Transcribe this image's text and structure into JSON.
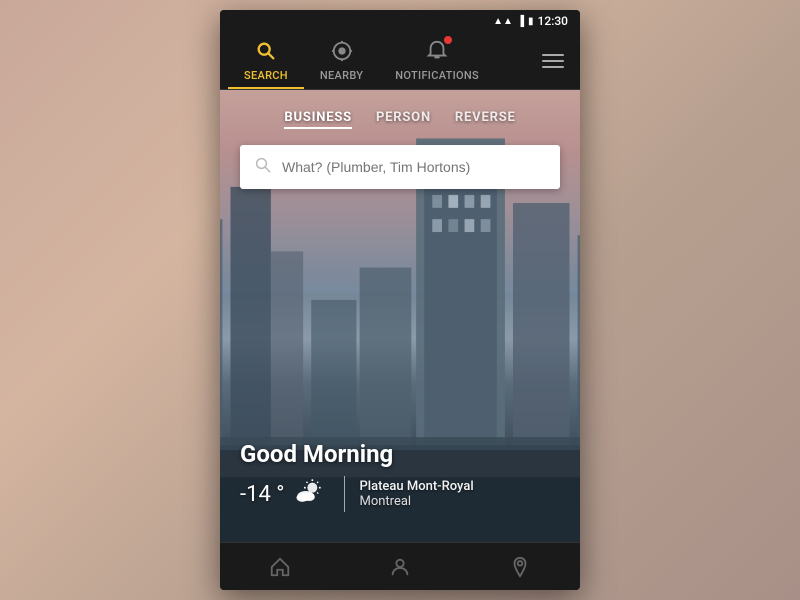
{
  "statusBar": {
    "time": "12:30",
    "icons": [
      "wifi",
      "signal",
      "battery"
    ]
  },
  "topNav": {
    "tabs": [
      {
        "id": "search",
        "label": "Search",
        "icon": "🔍",
        "active": true
      },
      {
        "id": "nearby",
        "label": "Nearby",
        "icon": "⊘",
        "active": false
      },
      {
        "id": "notifications",
        "label": "Notifications",
        "icon": "🔔",
        "active": false,
        "badge": true
      }
    ],
    "menuIcon": "☰"
  },
  "searchCategories": [
    {
      "id": "business",
      "label": "BUSINESS",
      "active": true
    },
    {
      "id": "person",
      "label": "PERSON",
      "active": false
    },
    {
      "id": "reverse",
      "label": "REVERSE",
      "active": false
    }
  ],
  "searchBox": {
    "placeholder": "What? (Plumber, Tim Hortons)"
  },
  "greeting": {
    "text": "Good Morning"
  },
  "weather": {
    "temperature": "-14 °",
    "location_neighborhood": "Plateau Mont-Royal",
    "location_city": "Montreal"
  },
  "bottomNav": {
    "items": [
      "🏠",
      "👤",
      "📍"
    ]
  }
}
